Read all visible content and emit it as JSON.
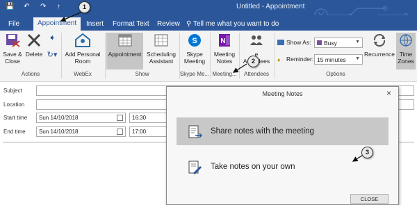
{
  "window": {
    "title": "Untitled  -  Appointment"
  },
  "tabs": [
    "File",
    "Appointment",
    "Insert",
    "Format Text",
    "Review"
  ],
  "tell_me": "Tell me what you want to do",
  "ribbon": {
    "actions": {
      "save_close": "Save &\nClose",
      "delete": "Delete",
      "group": "Actions"
    },
    "webex": {
      "add_room": "Add Personal\nRoom",
      "group": "WebEx"
    },
    "show": {
      "appointment": "Appointment",
      "scheduling": "Scheduling\nAssistant",
      "group": "Show"
    },
    "skype": {
      "skype_meeting": "Skype\nMeeting",
      "group": "Skype Me..."
    },
    "meeting_notes": {
      "label": "Meeting\nNotes",
      "group": "Meeting..."
    },
    "attendees": {
      "label": "e\nAttendees",
      "group": "Attendees"
    },
    "options": {
      "show_as_label": "Show As:",
      "show_as_value": "Busy",
      "reminder_label": "Reminder:",
      "reminder_value": "15 minutes",
      "recurrence": "Recurrence",
      "time_zones": "Time\nZones",
      "group": "Options"
    }
  },
  "form": {
    "subject_label": "Subject",
    "location_label": "Location",
    "start_label": "Start time",
    "start_date": "Sun 14/10/2018",
    "start_time": "16:30",
    "end_label": "End time",
    "end_date": "Sun 14/10/2018",
    "end_time": "17:00"
  },
  "dialog": {
    "title": "Meeting Notes",
    "close_glyph": "×",
    "option1": "Share notes with the meeting",
    "option2": "Take notes on your own",
    "close_button": "CLOSE"
  },
  "callouts": [
    "1",
    "2",
    "3"
  ],
  "colors": {
    "accent": "#2b579a",
    "onenote": "#7719aa",
    "busy": "#7a4f9f"
  }
}
